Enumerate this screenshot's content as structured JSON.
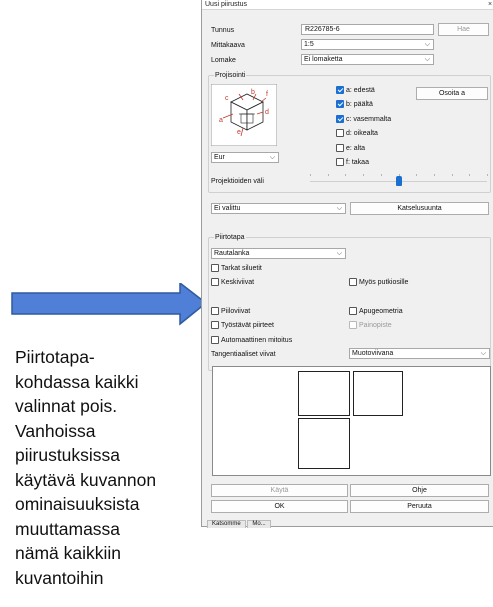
{
  "annotation": {
    "lines": [
      "Piirtotapa-",
      "kohdassa kaikki",
      "valinnat pois.",
      "Vanhoissa",
      "piirustuksissa",
      "käytävä kuvannon",
      "ominaisuuksista",
      "muuttamassa",
      "nämä kaikkiin",
      "kuvantoihin"
    ],
    "arrow_color": "#4f7fd6"
  },
  "dialog": {
    "title": "Uusi piirustus",
    "close_glyph": "×",
    "tunnus_label": "Tunnus",
    "tunnus_value": "R226785-6",
    "hae_button": "Hae",
    "mittakaava_label": "Mittakaava",
    "mittakaava_value": "1:5",
    "lomake_label": "Lomake",
    "lomake_value": "Ei lomaketta",
    "projisointi": {
      "title": "Projisointi",
      "standard_value": "Eur",
      "views": [
        {
          "label": "a: edestä",
          "checked": true
        },
        {
          "label": "b: päältä",
          "checked": true
        },
        {
          "label": "c: vasemmalta",
          "checked": true
        },
        {
          "label": "d: oikealta",
          "checked": false
        },
        {
          "label": "e: alta",
          "checked": false
        },
        {
          "label": "f: takaa",
          "checked": false
        }
      ],
      "nayta_button": "Osoita a",
      "spacing_label": "Projektioiden väli",
      "spacing_level": 0.5,
      "view_letters": [
        "c",
        "b",
        "f",
        "a",
        "d",
        "e"
      ]
    },
    "selection_value": "Ei valittu",
    "katselusuunta_button": "Katselusuunta",
    "piirtotapa": {
      "title": "Piirtotapa",
      "style_value": "Rautalanka",
      "options": [
        {
          "key": "tarkat",
          "label": "Tarkat siluetit",
          "checked": false,
          "enabled": true
        },
        {
          "key": "keskiviivat",
          "label": "Keskiviivat",
          "checked": false,
          "enabled": true
        },
        {
          "key": "putkiosat",
          "label": "Myös putkiosille",
          "checked": false,
          "enabled": true
        },
        {
          "key": "piiloviivat",
          "label": "Piiloviivat",
          "checked": false,
          "enabled": true
        },
        {
          "key": "apugeometria",
          "label": "Apugeometria",
          "checked": false,
          "enabled": true
        },
        {
          "key": "tyostavat",
          "label": "Työstävät piirteet",
          "checked": false,
          "enabled": true
        },
        {
          "key": "painopiste",
          "label": "Painopiste",
          "checked": false,
          "enabled": false
        },
        {
          "key": "automaattinen",
          "label": "Automaattinen mitoitus",
          "checked": false,
          "enabled": true
        }
      ],
      "tangent_label": "Tangentiaaliset viivat",
      "tangent_value": "Muotoviivana"
    },
    "kayta_button": "Käytä",
    "ohje_button": "Ohje",
    "ok_button": "OK",
    "peruuta_button": "Peruuta",
    "bottom_tabs": [
      "Katsomme",
      "Mo..."
    ]
  }
}
